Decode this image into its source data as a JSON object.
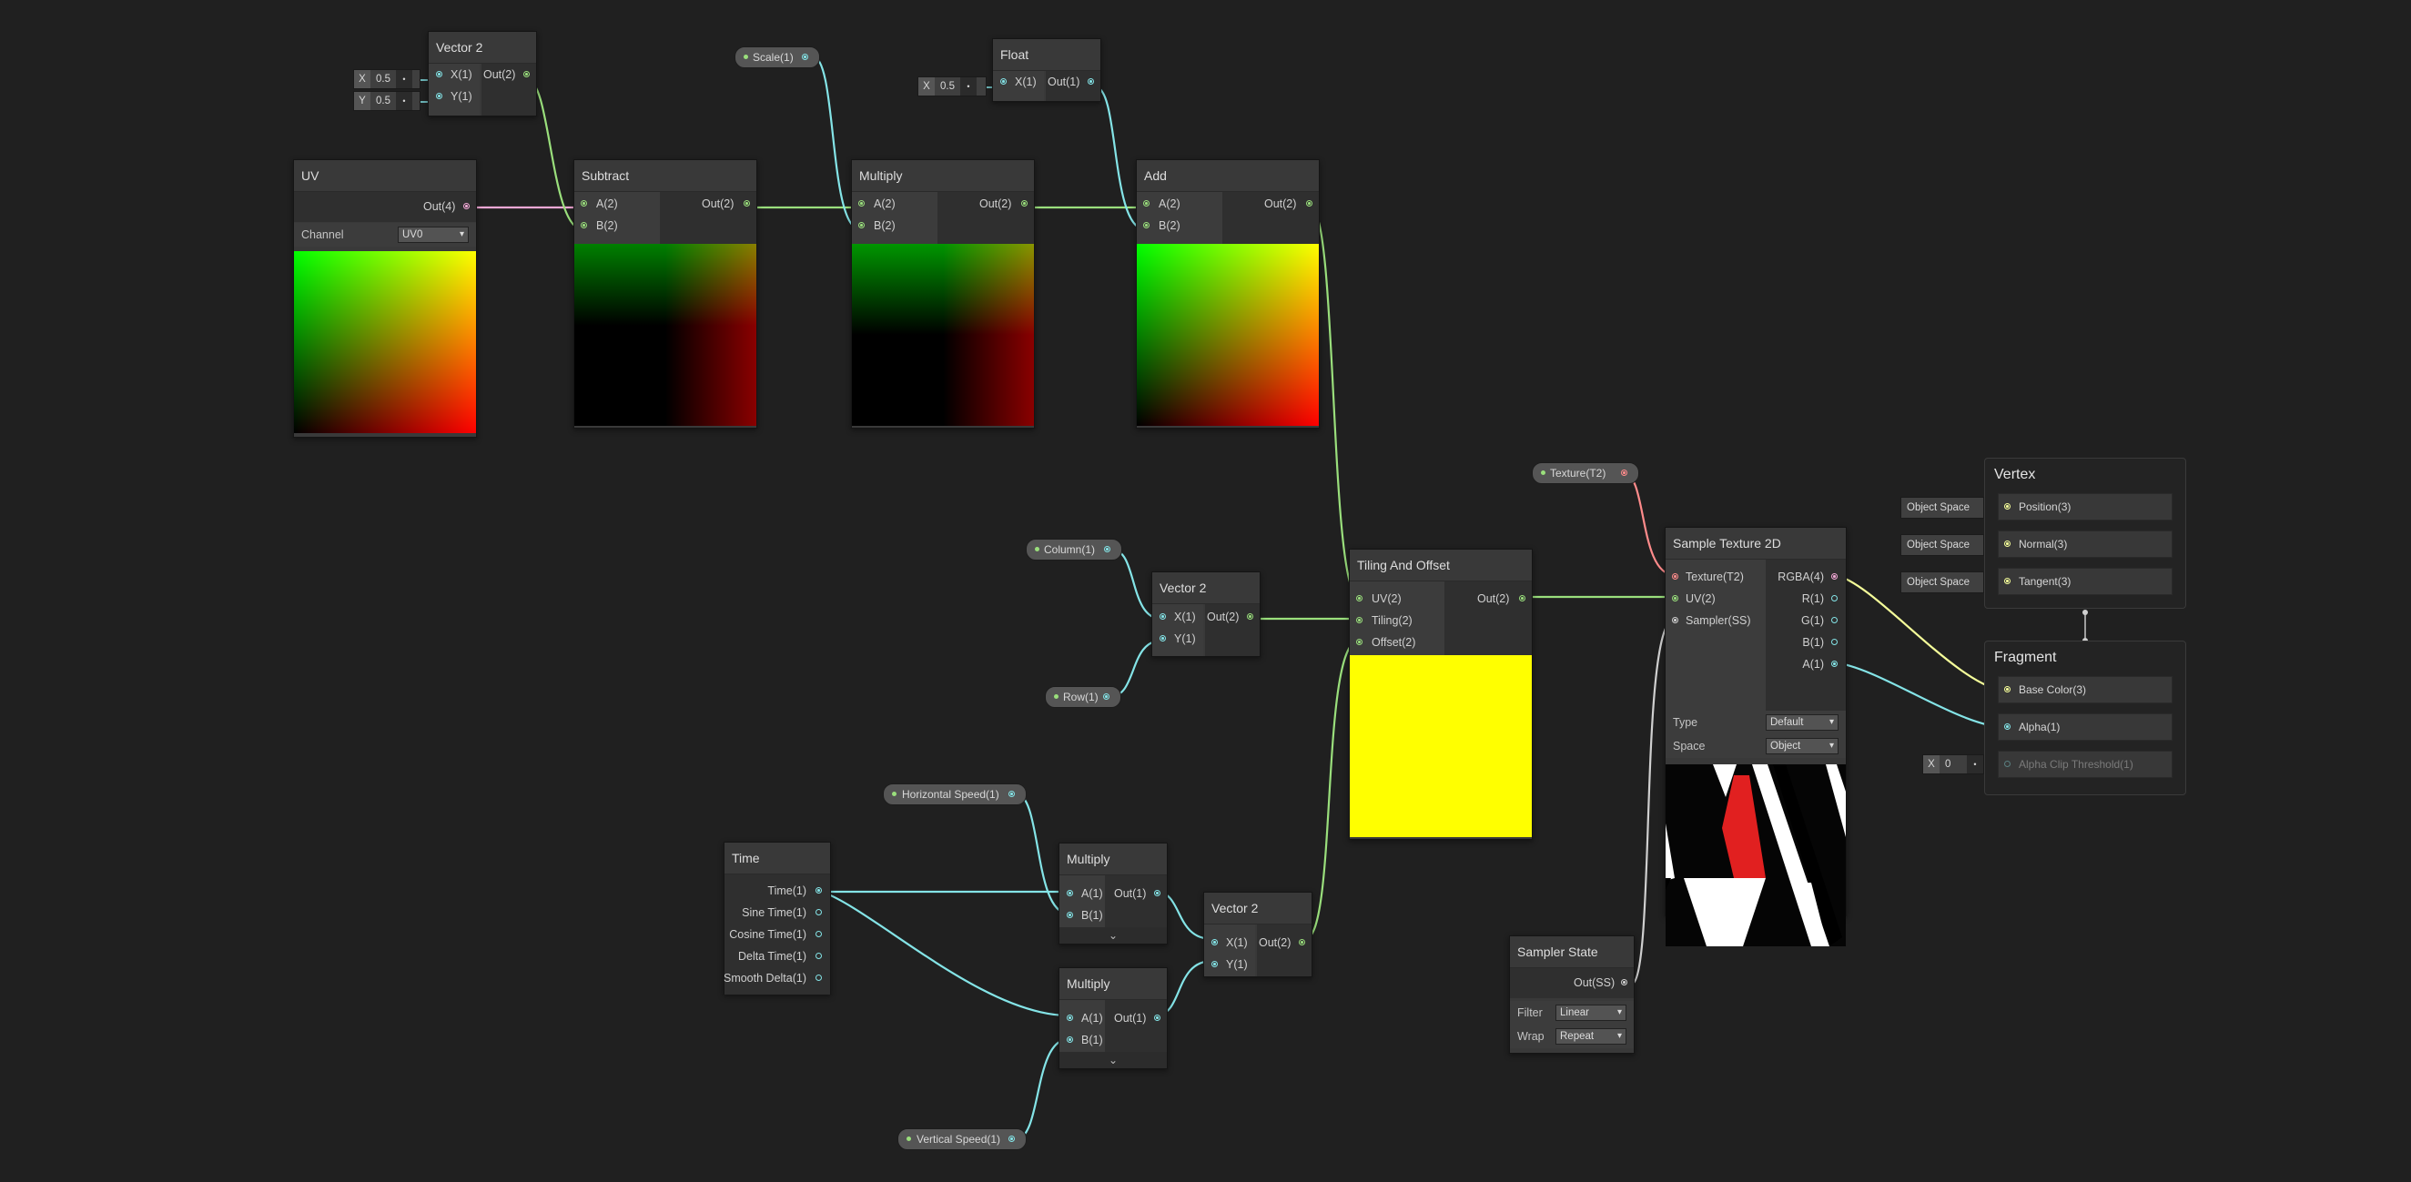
{
  "colors": {
    "vec2": "#9adf7c",
    "vec4": "#f2a8d6",
    "vec1": "#84e4e7",
    "tex": "#ff8b8b",
    "ss": "#d0d0d0",
    "vec3": "#f6ff9a"
  },
  "nodes": {
    "vector2_top": {
      "title": "Vector 2",
      "in": [
        "X(1)",
        "Y(1)"
      ],
      "out": "Out(2)",
      "x": "0.5",
      "y": "0.5"
    },
    "uv": {
      "title": "UV",
      "out": "Out(4)",
      "channel_label": "Channel",
      "channel_value": "UV0"
    },
    "subtract": {
      "title": "Subtract",
      "in": [
        "A(2)",
        "B(2)"
      ],
      "out": "Out(2)"
    },
    "multiply_top": {
      "title": "Multiply",
      "in": [
        "A(2)",
        "B(2)"
      ],
      "out": "Out(2)"
    },
    "float": {
      "title": "Float",
      "in": "X(1)",
      "out": "Out(1)",
      "x": "0.5"
    },
    "add": {
      "title": "Add",
      "in": [
        "A(2)",
        "B(2)"
      ],
      "out": "Out(2)"
    },
    "vector2_mid": {
      "title": "Vector 2",
      "in": [
        "X(1)",
        "Y(1)"
      ],
      "out": "Out(2)"
    },
    "tiling": {
      "title": "Tiling And Offset",
      "in": [
        "UV(2)",
        "Tiling(2)",
        "Offset(2)"
      ],
      "out": "Out(2)"
    },
    "sample_tex": {
      "title": "Sample Texture 2D",
      "in": [
        "Texture(T2)",
        "UV(2)",
        "Sampler(SS)"
      ],
      "out": [
        "RGBA(4)",
        "R(1)",
        "G(1)",
        "B(1)",
        "A(1)"
      ],
      "type_label": "Type",
      "type_value": "Default",
      "space_label": "Space",
      "space_value": "Object"
    },
    "time": {
      "title": "Time",
      "out": [
        "Time(1)",
        "Sine Time(1)",
        "Cosine Time(1)",
        "Delta Time(1)",
        "Smooth Delta(1)"
      ]
    },
    "multiply_a": {
      "title": "Multiply",
      "in": [
        "A(1)",
        "B(1)"
      ],
      "out": "Out(1)"
    },
    "multiply_b": {
      "title": "Multiply",
      "in": [
        "A(1)",
        "B(1)"
      ],
      "out": "Out(1)"
    },
    "vector2_bot": {
      "title": "Vector 2",
      "in": [
        "X(1)",
        "Y(1)"
      ],
      "out": "Out(2)"
    },
    "sampler_state": {
      "title": "Sampler State",
      "out": "Out(SS)",
      "filter_label": "Filter",
      "filter_value": "Linear",
      "wrap_label": "Wrap",
      "wrap_value": "Repeat"
    }
  },
  "properties": {
    "scale": "Scale(1)",
    "texture": "Texture(T2)",
    "column": "Column(1)",
    "row": "Row(1)",
    "hspeed": "Horizontal Speed(1)",
    "vspeed": "Vertical Speed(1)"
  },
  "vertex": {
    "title": "Vertex",
    "slots": [
      "Position(3)",
      "Normal(3)",
      "Tangent(3)"
    ],
    "space": "Object Space"
  },
  "fragment": {
    "title": "Fragment",
    "slots": [
      "Base Color(3)",
      "Alpha(1)",
      "Alpha Clip Threshold(1)"
    ],
    "clip_x": "0"
  }
}
